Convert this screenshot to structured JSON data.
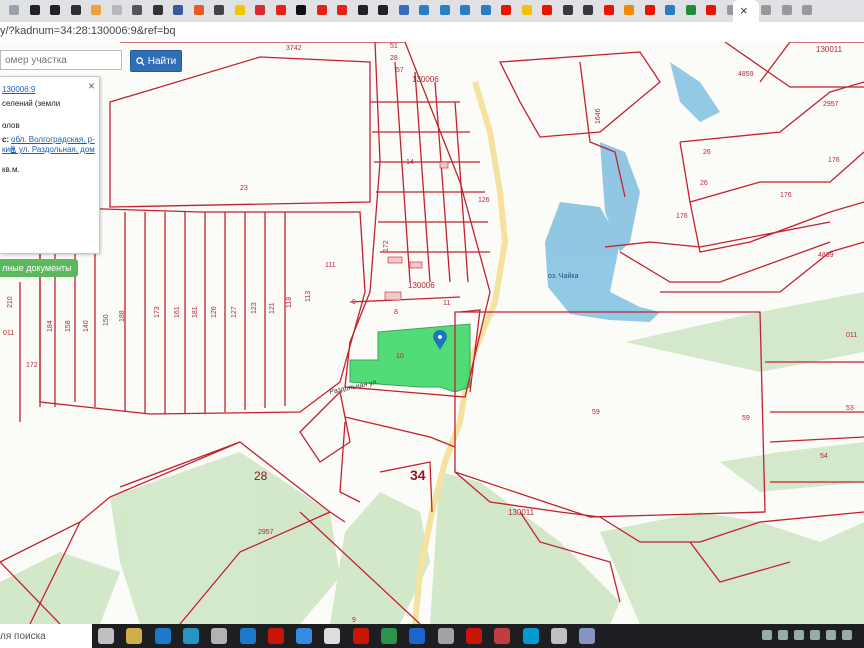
{
  "browser": {
    "tabs": [
      {
        "icon": "page-icon",
        "color": "#9aa3ad"
      },
      {
        "icon": "puzzle-icon",
        "color": "#222"
      },
      {
        "icon": "puzzle-icon",
        "color": "#222"
      },
      {
        "icon": "grid-icon",
        "color": "#2f2f2f"
      },
      {
        "icon": "folder-icon",
        "color": "#e8a33d"
      },
      {
        "icon": "grey-circle-icon",
        "color": "#b7b7b7"
      },
      {
        "icon": "bag-icon",
        "color": "#555"
      },
      {
        "icon": "n-icon",
        "color": "#333"
      },
      {
        "icon": "facebook-icon",
        "color": "#3b5998"
      },
      {
        "icon": "orange-circle-icon",
        "color": "#e55b21"
      },
      {
        "icon": "dark-circle-icon",
        "color": "#444"
      },
      {
        "icon": "yellow-square-icon",
        "color": "#f2c500"
      },
      {
        "icon": "lightning-icon",
        "color": "#d62b2b"
      },
      {
        "icon": "youtube-icon",
        "color": "#e62117"
      },
      {
        "icon": "zen-icon",
        "color": "#111"
      },
      {
        "icon": "youtube-icon",
        "color": "#e62117"
      },
      {
        "icon": "youtube-icon",
        "color": "#e62117"
      },
      {
        "icon": "w-icon",
        "color": "#222"
      },
      {
        "icon": "w-icon",
        "color": "#222"
      },
      {
        "icon": "wiki-icon",
        "color": "#3a6bbb"
      },
      {
        "icon": "box-icon",
        "color": "#2a7fc4"
      },
      {
        "icon": "box-icon",
        "color": "#2a7fc4"
      },
      {
        "icon": "box-icon",
        "color": "#2a7fc4"
      },
      {
        "icon": "box-icon",
        "color": "#2a7fc4"
      },
      {
        "icon": "yandex-icon",
        "color": "#e61400"
      },
      {
        "icon": "play-icon",
        "color": "#f4c20d"
      },
      {
        "icon": "yandex-icon",
        "color": "#e61400"
      },
      {
        "icon": "dark-circle-icon",
        "color": "#3a3a3a"
      },
      {
        "icon": "dark-circle-icon",
        "color": "#3a3a3a"
      },
      {
        "icon": "yandex-icon",
        "color": "#e61400"
      },
      {
        "icon": "orange-ring-icon",
        "color": "#f08a00"
      },
      {
        "icon": "yandex-icon",
        "color": "#e61400"
      },
      {
        "icon": "box-icon",
        "color": "#2a7fc4"
      },
      {
        "icon": "plus-icon",
        "color": "#1e8e3e"
      },
      {
        "icon": "yandex-icon",
        "color": "#e61400"
      },
      {
        "icon": "doc-icon",
        "color": "#999"
      },
      {
        "icon": "doc-icon",
        "color": "#999"
      },
      {
        "icon": "doc-icon",
        "color": "#999"
      },
      {
        "icon": "doc-icon",
        "color": "#999"
      }
    ],
    "active_tab_close": "×",
    "url": "y/?kadnum=34:28:130006:9&ref=bq"
  },
  "search": {
    "placeholder": "омер участка",
    "button_label": "Найти"
  },
  "info_panel": {
    "close": "×",
    "cadnum": "130006:9",
    "category": "селений (земли",
    "line2": "олов",
    "address_label": "с:",
    "address_line1": "обл. Волгоградская, р-н",
    "address_line2": "кий, ул. Раздольная, дом",
    "area": "кв.м.",
    "docs_button": "лные документы"
  },
  "map": {
    "accent_parcel_color": "#3fd96b",
    "boundary_color": "#c4212f",
    "water_color": "#7fbfe0",
    "forest_color": "#cfe5c5",
    "quarter_labels": [
      "130006",
      "130006",
      "130011",
      "130011"
    ],
    "district_labels": [
      "28",
      "34"
    ],
    "parcel_labels": [
      "3742",
      "4859",
      "2957",
      "23",
      "26",
      "176",
      "26",
      "176",
      "176",
      "4839",
      "111",
      "11",
      "8",
      "10",
      "59",
      "59",
      "53",
      "54",
      "2957",
      "172",
      "210",
      "184",
      "158",
      "140",
      "150",
      "188",
      "173",
      "161",
      "181",
      "126",
      "127",
      "123",
      "121",
      "118",
      "113",
      "51",
      "28",
      "57",
      "1646",
      "172",
      "9",
      "126",
      "14",
      "011",
      "011",
      "9"
    ],
    "lake_label": "оз. Чайка",
    "street_label": "Раздольная ул."
  },
  "taskbar": {
    "search_text": "ля поиска",
    "icons": [
      "task-view-icon",
      "file-explorer-icon",
      "store-icon",
      "photos-icon",
      "mail-icon",
      "edge-icon",
      "yandex-browser-icon",
      "copyright-icon",
      "document-icon",
      "opera-icon",
      "chrome-icon",
      "dark-app-icon",
      "camera-icon",
      "yandex-disk-icon",
      "app-icon",
      "skype-icon",
      "image-icon",
      "paint-icon"
    ],
    "tray": [
      "browser-tray-icon",
      "network-tray-icon",
      "wifi-tray-icon",
      "sound-tray-icon",
      "keyboard-tray-icon",
      "notification-tray-icon"
    ]
  }
}
